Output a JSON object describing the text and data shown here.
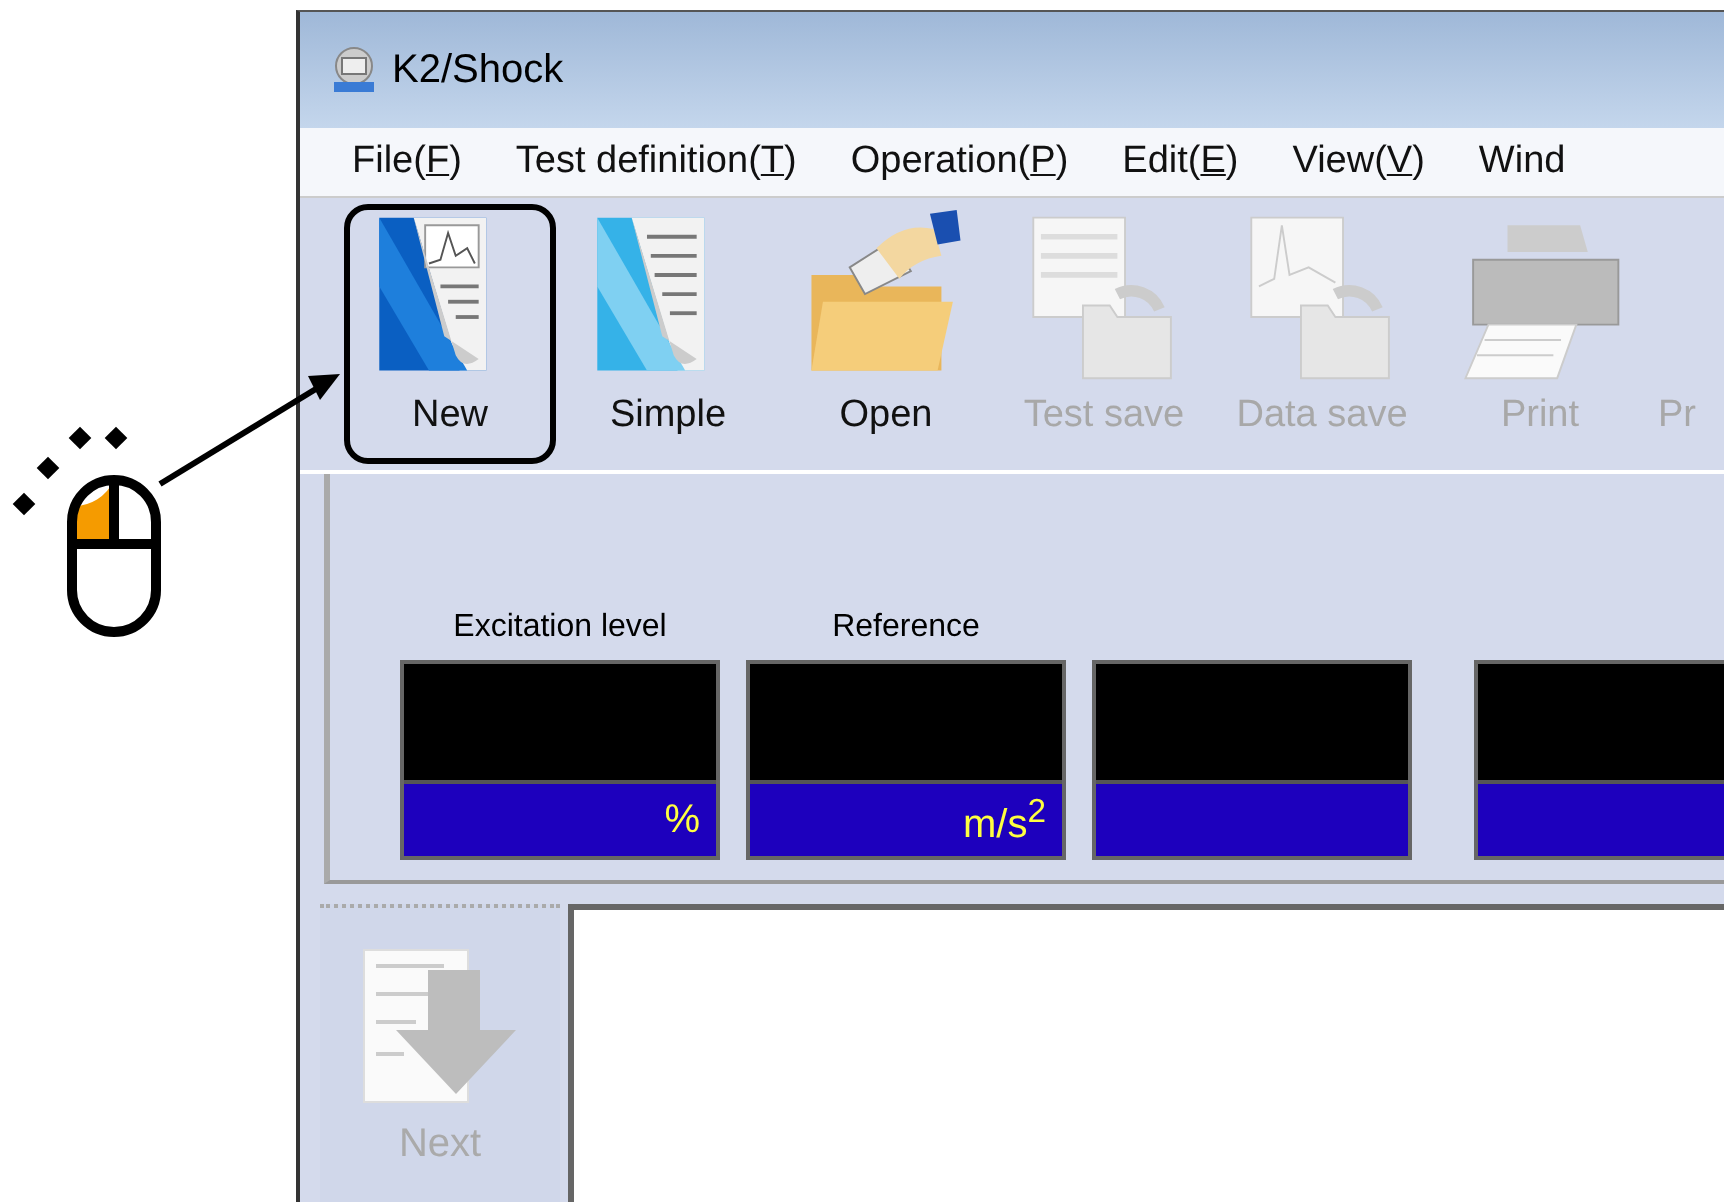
{
  "window": {
    "title": "K2/Shock"
  },
  "menu": [
    {
      "label": "File(F)"
    },
    {
      "label": "Test definition(T)"
    },
    {
      "label": "Operation(P)"
    },
    {
      "label": "Edit(E)"
    },
    {
      "label": "View(V)"
    },
    {
      "label": "Wind"
    }
  ],
  "toolbar": [
    {
      "kind": "new",
      "label": "New",
      "disabled": false,
      "highlighted": true
    },
    {
      "kind": "simple",
      "label": "Simple",
      "disabled": false,
      "highlighted": false
    },
    {
      "kind": "open",
      "label": "Open",
      "disabled": false,
      "highlighted": false
    },
    {
      "kind": "test-save",
      "label": "Test save",
      "disabled": true,
      "highlighted": false
    },
    {
      "kind": "data-save",
      "label": "Data save",
      "disabled": true,
      "highlighted": false
    },
    {
      "kind": "print",
      "label": "Print",
      "disabled": true,
      "highlighted": false
    },
    {
      "kind": "print",
      "label": "Pr",
      "disabled": true,
      "highlighted": false
    }
  ],
  "meters": [
    {
      "kind": "labeled",
      "label": "Excitation level",
      "unit": "%"
    },
    {
      "kind": "labeled",
      "label": "Reference",
      "unit": "m/s$^{2}$"
    },
    {
      "kind": "blank"
    },
    {
      "kind": "blank"
    }
  ],
  "side_buttons": [
    {
      "kind": "next",
      "label": "Next",
      "disabled": true
    }
  ],
  "callout": {
    "left_pressed": true
  }
}
